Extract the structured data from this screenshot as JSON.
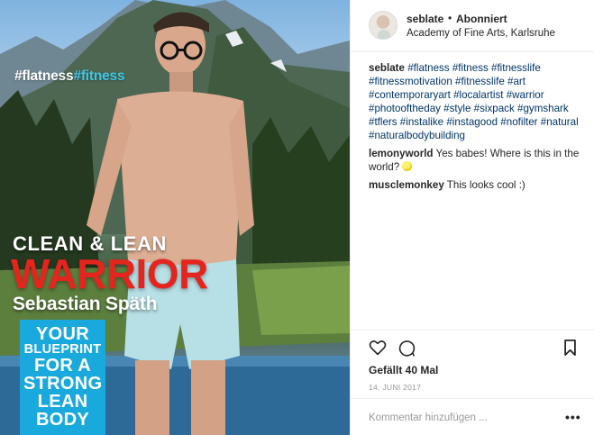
{
  "post_image": {
    "tagline_part1": "#flatness",
    "tagline_part2": "#fitness",
    "cover_subtitle": "CLEAN & LEAN",
    "cover_title": "WARRIOR",
    "cover_name": "Sebastian Späth",
    "blueprint_lines": [
      "YOUR",
      "BLUEPRINT",
      "FOR A",
      "STRONG",
      "LEAN",
      "BODY"
    ]
  },
  "header": {
    "username": "seblate",
    "separator": "•",
    "follow_status": "Abonniert",
    "location": "Academy of Fine Arts, Karlsruhe"
  },
  "caption": {
    "username": "seblate",
    "text": "#flatness #fitness #fitnesslife #fitnessmotivation #fitnesslife #art #contemporaryart #localartist #warrior #photooftheday #style #sixpack #gymshark #tflers #instalike #instagood #nofilter #natural #naturalbodybuilding"
  },
  "comments": [
    {
      "username": "lemonyworld",
      "text": "Yes babes! Where is this in the world?",
      "emoji": "lemon"
    },
    {
      "username": "musclemonkey",
      "text": "This looks cool :)"
    }
  ],
  "actions": {
    "like_icon": "heart-icon",
    "comment_icon": "comment-icon",
    "save_icon": "bookmark-icon"
  },
  "likes_text": "Gefällt 40 Mal",
  "date_text": "14. JUNI 2017",
  "add_comment": {
    "placeholder": "Kommentar hinzufügen ...",
    "more_label": "•••"
  },
  "colors": {
    "hashtag": "#003569",
    "cover_red": "#e4251d",
    "cover_blue": "#1aa9dc",
    "tagline_cyan": "#3fc7e8"
  }
}
